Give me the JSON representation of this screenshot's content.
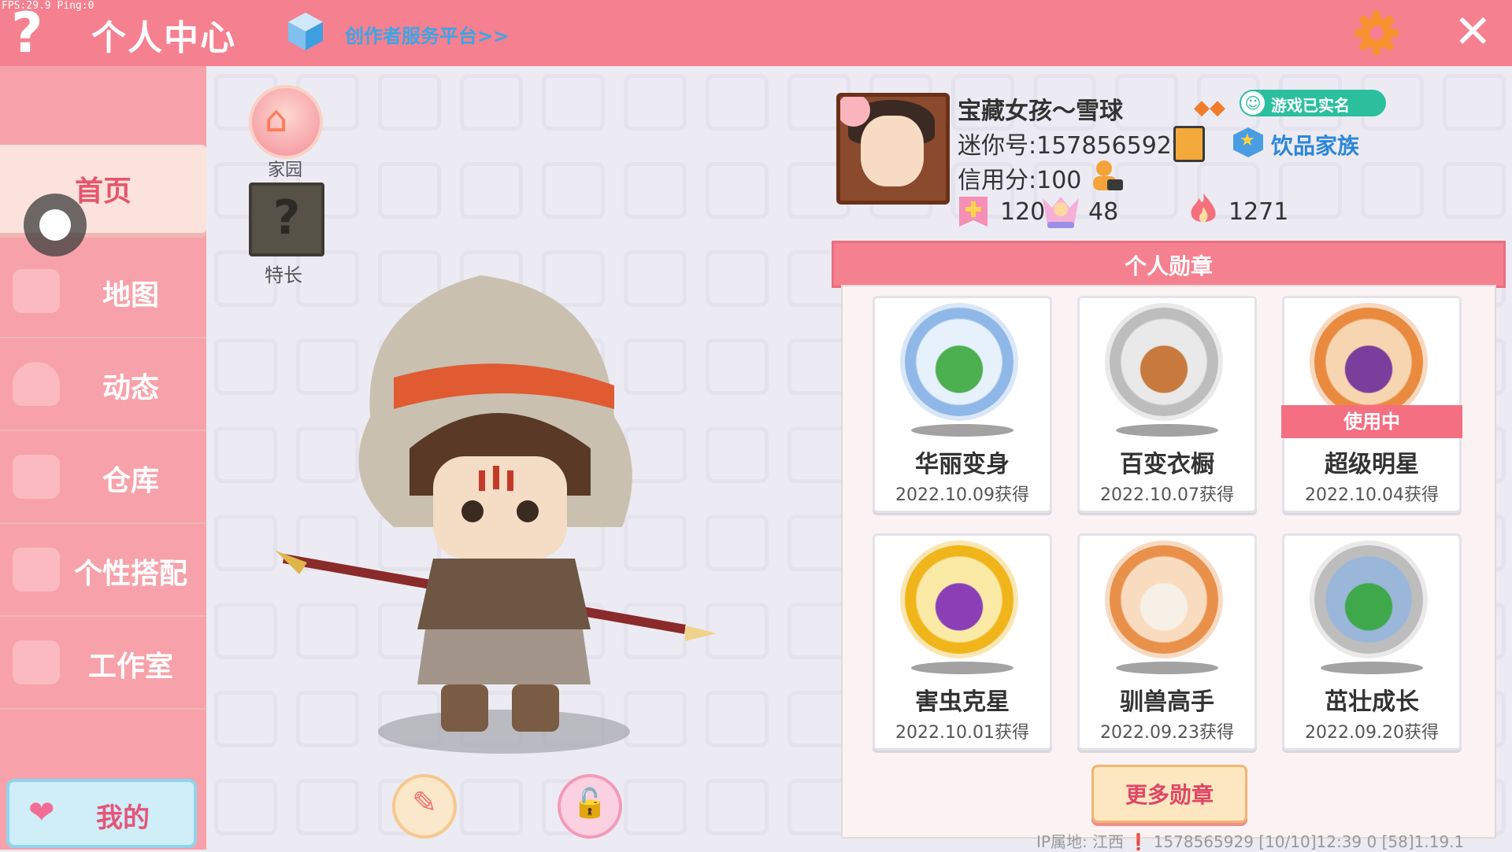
{
  "debug": {
    "fps": "FPS:29.9  Ping:0"
  },
  "header": {
    "help_glyph": "?",
    "title": "个人中心",
    "creator_link": "创作者服务平台>>",
    "close_glyph": "✕"
  },
  "sidebar": {
    "items": [
      {
        "label": "首页"
      },
      {
        "label": "地图"
      },
      {
        "label": "动态"
      },
      {
        "label": "仓库"
      },
      {
        "label": "个性搭配"
      },
      {
        "label": "工作室"
      }
    ],
    "mine_label": "我的"
  },
  "avatar_panel": {
    "home_label": "家园",
    "specialty_label": "特长",
    "specialty_glyph": "?"
  },
  "profile": {
    "nickname": "宝藏女孩～雪球",
    "verified": "游戏已实名",
    "mini_id": "迷你号:1578565929",
    "family": "饮品家族",
    "credit": "信用分:100",
    "stats": [
      {
        "icon": "plus-badge-icon",
        "value": "120"
      },
      {
        "icon": "fans-icon",
        "value": "48"
      },
      {
        "icon": "flame-icon",
        "value": "1271"
      }
    ]
  },
  "medals": {
    "header": "个人勋章",
    "items": [
      {
        "name": "华丽变身",
        "date": "2022.10.09获得",
        "ring": "#8fb8e8",
        "core": "#e6f1fb",
        "accent": "#4caf50",
        "in_use": false
      },
      {
        "name": "百变衣橱",
        "date": "2022.10.07获得",
        "ring": "#bdbdbd",
        "core": "#e9e9e9",
        "accent": "#c87a3e",
        "in_use": false
      },
      {
        "name": "超级明星",
        "date": "2022.10.04获得",
        "ring": "#e98a3f",
        "core": "#f7d5b0",
        "accent": "#7a3f9c",
        "in_use": true
      },
      {
        "name": "害虫克星",
        "date": "2022.10.01获得",
        "ring": "#f0b51a",
        "core": "#fbe9a6",
        "accent": "#8a3fb6",
        "in_use": false
      },
      {
        "name": "驯兽高手",
        "date": "2022.09.23获得",
        "ring": "#e9904a",
        "core": "#f9dcc0",
        "accent": "#f6f0e6",
        "in_use": false
      },
      {
        "name": "茁壮成长",
        "date": "2022.09.20获得",
        "ring": "#bdbdbd",
        "core": "#9ab6d8",
        "accent": "#3fa84a",
        "in_use": false
      }
    ],
    "in_use_label": "使用中",
    "more_label": "更多勋章"
  },
  "footer": {
    "text": "IP属地: 江西 ❗     1578565929  [10/10]12:39 0  [58]1.19.1"
  }
}
